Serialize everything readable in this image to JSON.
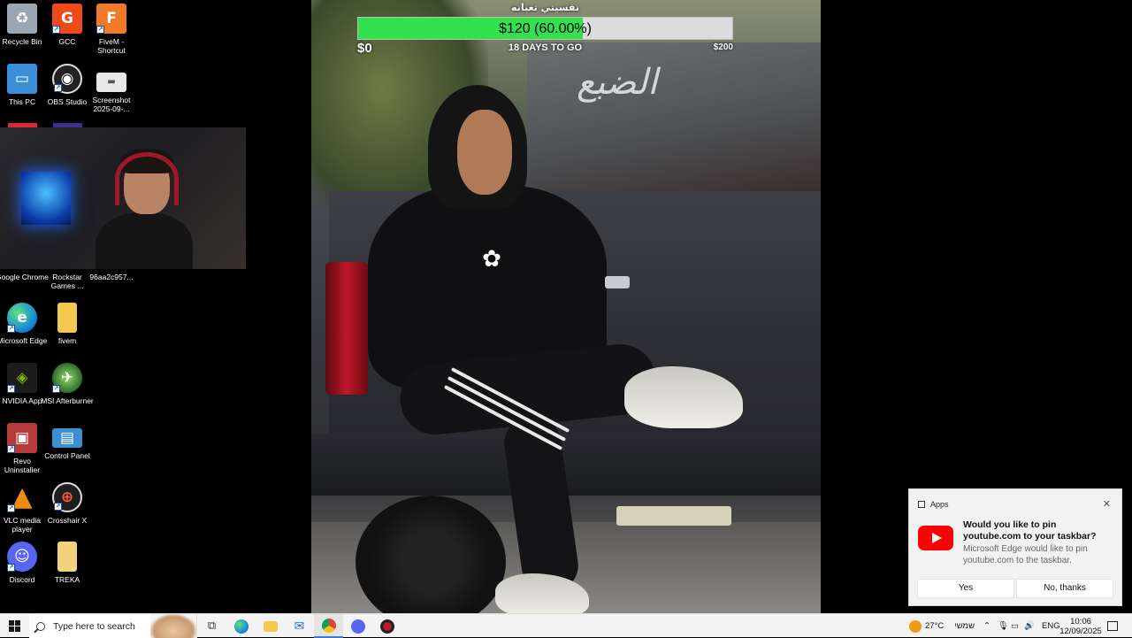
{
  "desktop": {
    "icons": [
      {
        "label": "Recycle Bin",
        "icon": "recycle-bin-icon",
        "color": "#9aa7b2",
        "glyph": "♻"
      },
      {
        "label": "GCC",
        "icon": "gcc-icon",
        "color": "#f04a1b",
        "glyph": "G"
      },
      {
        "label": "FiveM - Shortcut",
        "icon": "fivem-icon",
        "color": "#f07a2a",
        "glyph": "F"
      },
      {
        "label": "This PC",
        "icon": "computer-icon",
        "color": "#3b8fd9",
        "glyph": "▭"
      },
      {
        "label": "OBS Studio",
        "icon": "obs-icon",
        "color": "#222222",
        "glyph": "◉"
      },
      {
        "label": "Screenshot 2025-09-...",
        "icon": "screenshot-file-icon",
        "color": "#e8e8e8",
        "glyph": "▬"
      },
      {
        "label": "Google Chrome",
        "icon": "chrome-icon",
        "color": "#2f9e4f",
        "glyph": "◎"
      },
      {
        "label": "Rockstar Games ...",
        "icon": "rockstar-icon",
        "color": "#e6a800",
        "glyph": "R"
      },
      {
        "label": "96aa2c957...",
        "icon": "file-icon",
        "color": "#8a8a8a",
        "glyph": "▫"
      },
      {
        "label": "Microsoft Edge",
        "icon": "edge-icon",
        "color": "#1a8fd8",
        "glyph": "e"
      },
      {
        "label": "fivem",
        "icon": "folder-icon",
        "color": "#f2c94c",
        "glyph": "▰"
      },
      {
        "label": "NVIDIA App",
        "icon": "nvidia-icon",
        "color": "#2f7d1c",
        "glyph": "◈"
      },
      {
        "label": "MSI Afterburner",
        "icon": "msi-afterburner-icon",
        "color": "#4a6d2f",
        "glyph": "✈"
      },
      {
        "label": "Revo Uninstaller",
        "icon": "revo-uninstaller-icon",
        "color": "#b53a3a",
        "glyph": "▣"
      },
      {
        "label": "Control Panel",
        "icon": "control-panel-icon",
        "color": "#3a8fd0",
        "glyph": "▤"
      },
      {
        "label": "VLC media player",
        "icon": "vlc-icon",
        "color": "#f08b12",
        "glyph": "▲"
      },
      {
        "label": "Crosshair X",
        "icon": "crosshair-icon",
        "color": "#1e1e1e",
        "glyph": "⊕"
      },
      {
        "label": "Discord",
        "icon": "discord-icon",
        "color": "#5865f2",
        "glyph": "☺"
      },
      {
        "label": "TREKA",
        "icon": "folder-icon",
        "color": "#f2d27a",
        "glyph": "▰"
      }
    ]
  },
  "goal": {
    "title": "نفسيتي تعبانه",
    "progress_text": "$120 (60.00%)",
    "progress_fraction": 0.6,
    "start_amount": "$0",
    "days_left": "18 DAYS TO GO",
    "goal_amount": "$200",
    "fill_color": "#33e14e"
  },
  "stream": {
    "window_lettering": "الضبع"
  },
  "toast": {
    "app_name": "Apps",
    "heading": "Would you like to pin youtube.com to your taskbar?",
    "body": "Microsoft Edge would like to pin youtube.com to the taskbar.",
    "yes_label": "Yes",
    "no_label": "No, thanks",
    "close_glyph": "✕"
  },
  "taskbar": {
    "search_placeholder": "Type here to search",
    "apps": [
      {
        "name": "task-view",
        "glyph": "⧉",
        "color": "#333333"
      },
      {
        "name": "edge",
        "glyph": "e",
        "color": "#1a8fd8"
      },
      {
        "name": "file-explorer",
        "glyph": "▰",
        "color": "#f2c94c"
      },
      {
        "name": "mail",
        "glyph": "✉",
        "color": "#1a6fc2"
      },
      {
        "name": "chrome",
        "glyph": "◎",
        "color": "#2f9e4f"
      },
      {
        "name": "discord",
        "glyph": "☺",
        "color": "#5865f2"
      },
      {
        "name": "recorder",
        "glyph": "◉",
        "color": "#c0172a"
      }
    ],
    "weather": "27°C",
    "weather_desc": "שמשי",
    "language": "ENG",
    "time": "10:06",
    "date": "12/09/2025"
  }
}
